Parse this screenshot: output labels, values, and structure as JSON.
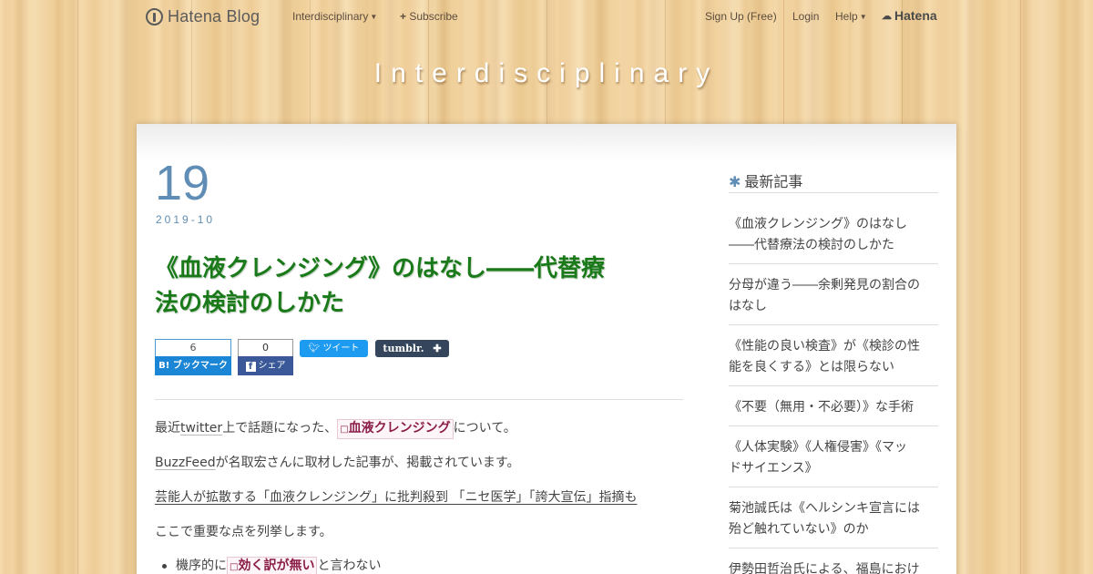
{
  "globalheader": {
    "logo_text": "Hatena Blog",
    "blog_menu": "Interdisciplinary",
    "subscribe": "Subscribe",
    "signup": "Sign Up (Free)",
    "login": "Login",
    "help": "Help",
    "hatena": "Hatena"
  },
  "blog": {
    "title": "Interdisciplinary"
  },
  "entry": {
    "date_day": "19",
    "date_ym": "2019-10",
    "title_line1": "《血液クレンジング》のはなし――代替療",
    "title_line2": "法の検討のしかた",
    "share": {
      "hatena_count": "6",
      "hatena_label": "B! ブックマーク",
      "facebook_count": "0",
      "facebook_label": "シェア",
      "twitter_label": "ツイート",
      "tumblr_label": "tumblr."
    },
    "p1_a": "最近",
    "p1_link": "twitter",
    "p1_b": "上で話題になった、",
    "p1_keyword": "血液クレンジング",
    "p1_c": "について。",
    "p2_link": "BuzzFeed",
    "p2_b": "が名取宏さんに取材した記事が、掲載されています。",
    "p3_link": "芸能人が拡散する「血液クレンジング」に批判殺到 「ニセ医学」「誇大宣伝」指摘も",
    "p4": "ここで重要な点を列挙します。",
    "li1_a": "機序的に",
    "li1_keyword": "効く訳が無い",
    "li1_b": "と言わない"
  },
  "sidebar": {
    "heading": "最新記事",
    "items": [
      {
        "line1": "《血液クレンジング》のはなし",
        "line2": "――代替療法の検討のしかた"
      },
      {
        "line1": "分母が違う――余剰発見の割合の",
        "line2": "はなし"
      },
      {
        "line1": "《性能の良い検査》が《検診の性",
        "line2": "能を良くする》とは限らない"
      },
      {
        "line1": "《不要（無用・不必要）》な手術",
        "line2": ""
      },
      {
        "line1": "《人体実験》《人権侵害》《マッ",
        "line2": "ドサイエンス》"
      },
      {
        "line1": "菊池誠氏は《ヘルシンキ宣言には",
        "line2": "殆ど触れていない》のか"
      },
      {
        "line1": "伊勢田哲治氏による、福島におけ",
        "line2": ""
      }
    ]
  },
  "colors": {
    "title_green": "#1a7a1a",
    "date_blue": "#5f8db5",
    "keyword": "#8b1d47",
    "hatena_blue": "#1c86d6",
    "facebook_blue": "#3b5998",
    "tumblr_navy": "#35465c"
  }
}
